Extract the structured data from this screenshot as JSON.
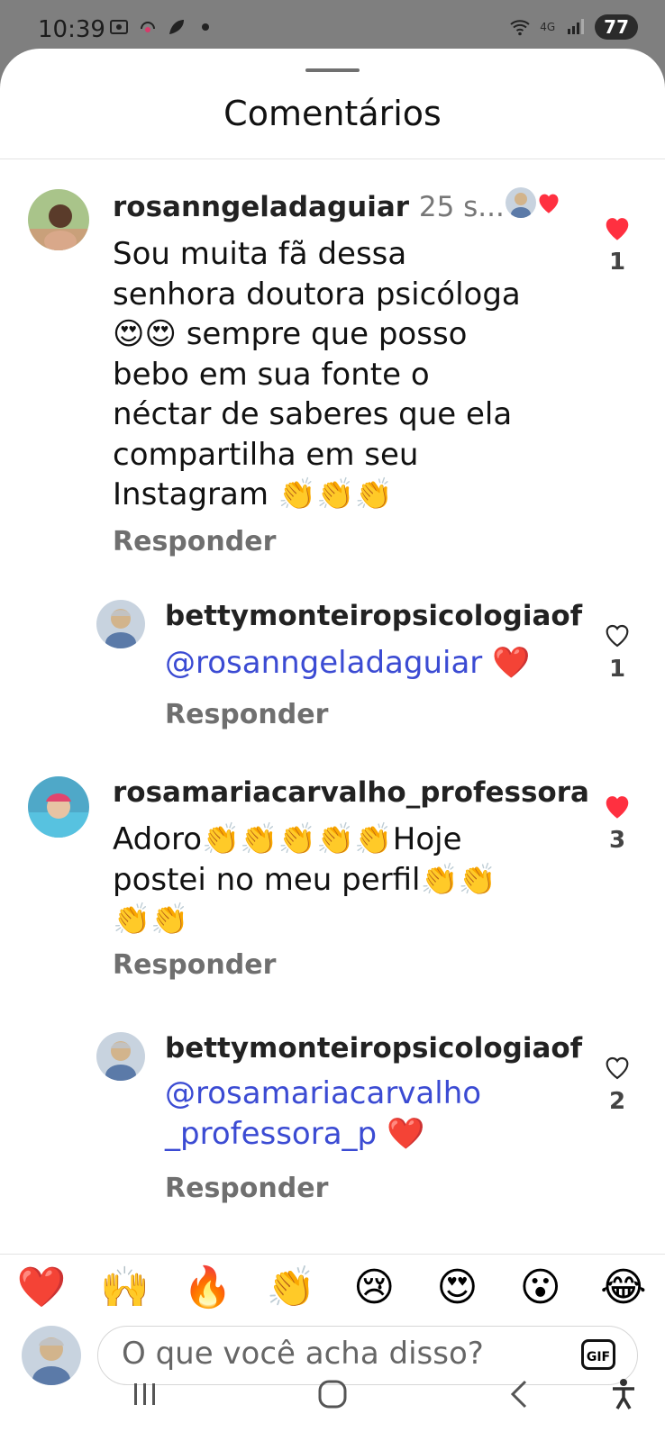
{
  "status_bar": {
    "time": "10:39",
    "network": "4G",
    "battery": "77"
  },
  "sheet": {
    "title": "Comentários"
  },
  "comments": [
    {
      "username": "rosanngeladaguiar",
      "time": "25 s...",
      "text": "Sou muita fã dessa\nsenhora doutora psicóloga\n😍😍 sempre que posso\nbebo em sua fonte  o\nnéctar de saberes que ela\ncompartilha em seu\nInstagram 👏👏👏",
      "reply_label": "Responder",
      "likes": "1",
      "liked": true
    },
    {
      "username": "bettymonteiropsicologiaof",
      "mention": "@rosanngeladaguiar",
      "text": " ❤️",
      "reply_label": "Responder",
      "likes": "1",
      "liked": false
    },
    {
      "username": "rosamariacarvalho_professora",
      "text": "Adoro👏👏👏👏👏Hoje\npostei no meu perfil👏👏\n👏👏",
      "reply_label": "Responder",
      "likes": "3",
      "liked": true
    },
    {
      "username": "bettymonteiropsicologiaof",
      "mention": "@rosamariacarvalho\n_professora_p",
      "text": " ❤️",
      "reply_label": "Responder",
      "likes": "2",
      "liked": false
    }
  ],
  "emoji_bar": [
    "❤️",
    "🙌",
    "🔥",
    "👏",
    "😢",
    "😍",
    "😮",
    "😂"
  ],
  "input": {
    "placeholder": "O que você acha disso?",
    "gif_label": "GIF"
  },
  "icons": {
    "heart_filled_color": "#ff3040",
    "heart_outline_color": "#262626",
    "mention_color": "#3b4bd3"
  }
}
